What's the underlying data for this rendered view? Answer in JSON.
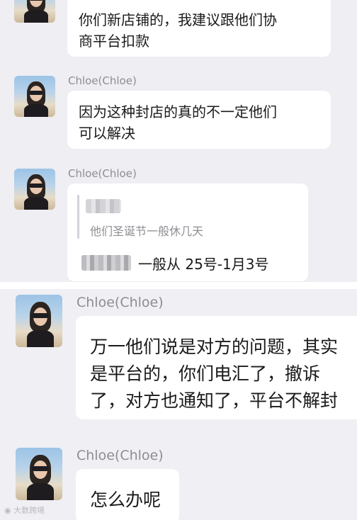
{
  "panel_top": {
    "messages": [
      {
        "sender": "",
        "lines": [
          "你们新店铺的，我建议跟他们协",
          "商平台扣款"
        ]
      },
      {
        "sender": "Chloe(Chloe)",
        "lines": [
          "因为这种封店的真的不一定他们",
          "可以解决"
        ]
      },
      {
        "sender": "Chloe(Chloe)",
        "quote_text": "他们圣诞节一般休几天",
        "reply_text": "一般从 25号-1月3号"
      }
    ]
  },
  "panel_bottom": {
    "messages": [
      {
        "sender": "Chloe(Chloe)",
        "lines": [
          "万一他们说是对方的问题，其实",
          "是平台的，你们电汇了，撤诉",
          "了，对方也通知了，平台不解封"
        ]
      },
      {
        "sender": "Chloe(Chloe)",
        "lines": [
          "怎么办呢"
        ]
      }
    ]
  },
  "watermark": "大数跨境",
  "colors": {
    "background": "#eeeef3",
    "bubble": "#ffffff",
    "sender_name": "#8d8d93",
    "text": "#1a1a1a"
  }
}
